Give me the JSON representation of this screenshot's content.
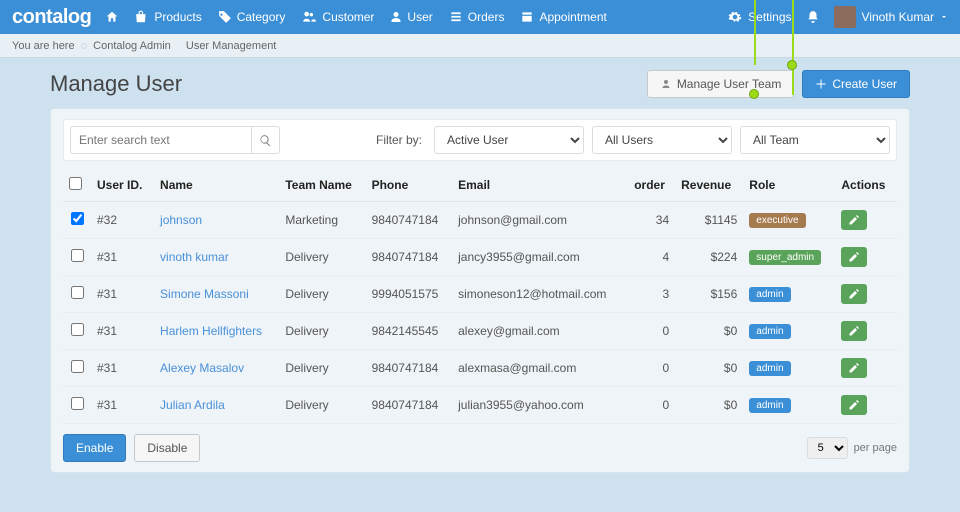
{
  "brand": "contalog",
  "nav": {
    "items": [
      {
        "label": "",
        "icon": "home"
      },
      {
        "label": "Products",
        "icon": "bag"
      },
      {
        "label": "Category",
        "icon": "tags"
      },
      {
        "label": "Customer",
        "icon": "users"
      },
      {
        "label": "User",
        "icon": "user"
      },
      {
        "label": "Orders",
        "icon": "list"
      },
      {
        "label": "Appointment",
        "icon": "calendar"
      }
    ],
    "right": {
      "settings": "Settings",
      "user": "Vinoth Kumar"
    }
  },
  "breadcrumb": {
    "prefix": "You are here",
    "items": [
      "Contalog Admin",
      "User Management"
    ]
  },
  "page": {
    "title": "Manage User",
    "manage_team": "Manage User Team",
    "create_user": "Create User"
  },
  "filters": {
    "search_placeholder": "Enter search text",
    "label": "Filter by:",
    "status": "Active User",
    "users": "All Users",
    "team": "All Team"
  },
  "table": {
    "headers": {
      "userid": "User ID.",
      "name": "Name",
      "team": "Team Name",
      "phone": "Phone",
      "email": "Email",
      "order": "order",
      "revenue": "Revenue",
      "role": "Role",
      "actions": "Actions"
    },
    "rows": [
      {
        "checked": true,
        "id": "#32",
        "name": "johnson",
        "team": "Marketing",
        "phone": "9840747184",
        "email": "johnson@gmail.com",
        "order": "34",
        "revenue": "$1145",
        "role": "executive",
        "role_class": "exec"
      },
      {
        "checked": false,
        "id": "#31",
        "name": "vinoth kumar",
        "team": "Delivery",
        "phone": "9840747184",
        "email": "jancy3955@gmail.com",
        "order": "4",
        "revenue": "$224",
        "role": "super_admin",
        "role_class": "super"
      },
      {
        "checked": false,
        "id": "#31",
        "name": "Simone Massoni",
        "team": "Delivery",
        "phone": "9994051575",
        "email": "simoneson12@hotmail.com",
        "order": "3",
        "revenue": "$156",
        "role": "admin",
        "role_class": "admin"
      },
      {
        "checked": false,
        "id": "#31",
        "name": "Harlem Hellfighters",
        "team": "Delivery",
        "phone": "9842145545",
        "email": "alexey@gmail.com",
        "order": "0",
        "revenue": "$0",
        "role": "admin",
        "role_class": "admin"
      },
      {
        "checked": false,
        "id": "#31",
        "name": "Alexey Masalov",
        "team": "Delivery",
        "phone": "9840747184",
        "email": "alexmasa@gmail.com",
        "order": "0",
        "revenue": "$0",
        "role": "admin",
        "role_class": "admin"
      },
      {
        "checked": false,
        "id": "#31",
        "name": "Julian Ardila",
        "team": "Delivery",
        "phone": "9840747184",
        "email": "julian3955@yahoo.com",
        "order": "0",
        "revenue": "$0",
        "role": "admin",
        "role_class": "admin"
      }
    ]
  },
  "footer": {
    "enable": "Enable",
    "disable": "Disable",
    "perpage_value": "5",
    "perpage_label": "per page"
  }
}
